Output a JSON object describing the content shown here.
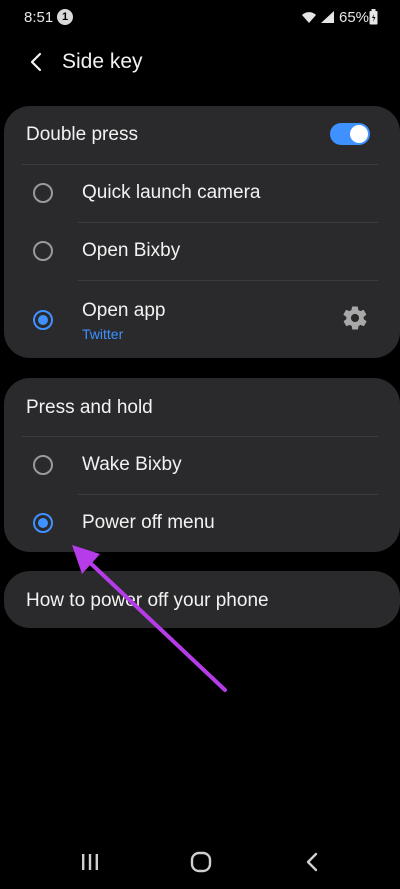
{
  "status_bar": {
    "time": "8:51",
    "notification_count": "1",
    "battery_percent": "65%"
  },
  "header": {
    "title": "Side key"
  },
  "double_press": {
    "title": "Double press",
    "toggle_on": true,
    "options": [
      {
        "label": "Quick launch camera",
        "selected": false
      },
      {
        "label": "Open Bixby",
        "selected": false
      },
      {
        "label": "Open app",
        "sub": "Twitter",
        "selected": true
      }
    ]
  },
  "press_and_hold": {
    "title": "Press and hold",
    "options": [
      {
        "label": "Wake Bixby",
        "selected": false
      },
      {
        "label": "Power off menu",
        "selected": true
      }
    ]
  },
  "help_link": {
    "label": "How to power off your phone"
  },
  "colors": {
    "accent": "#3e91ff",
    "card": "#2a2a2c",
    "annotation": "#b53ce8"
  }
}
